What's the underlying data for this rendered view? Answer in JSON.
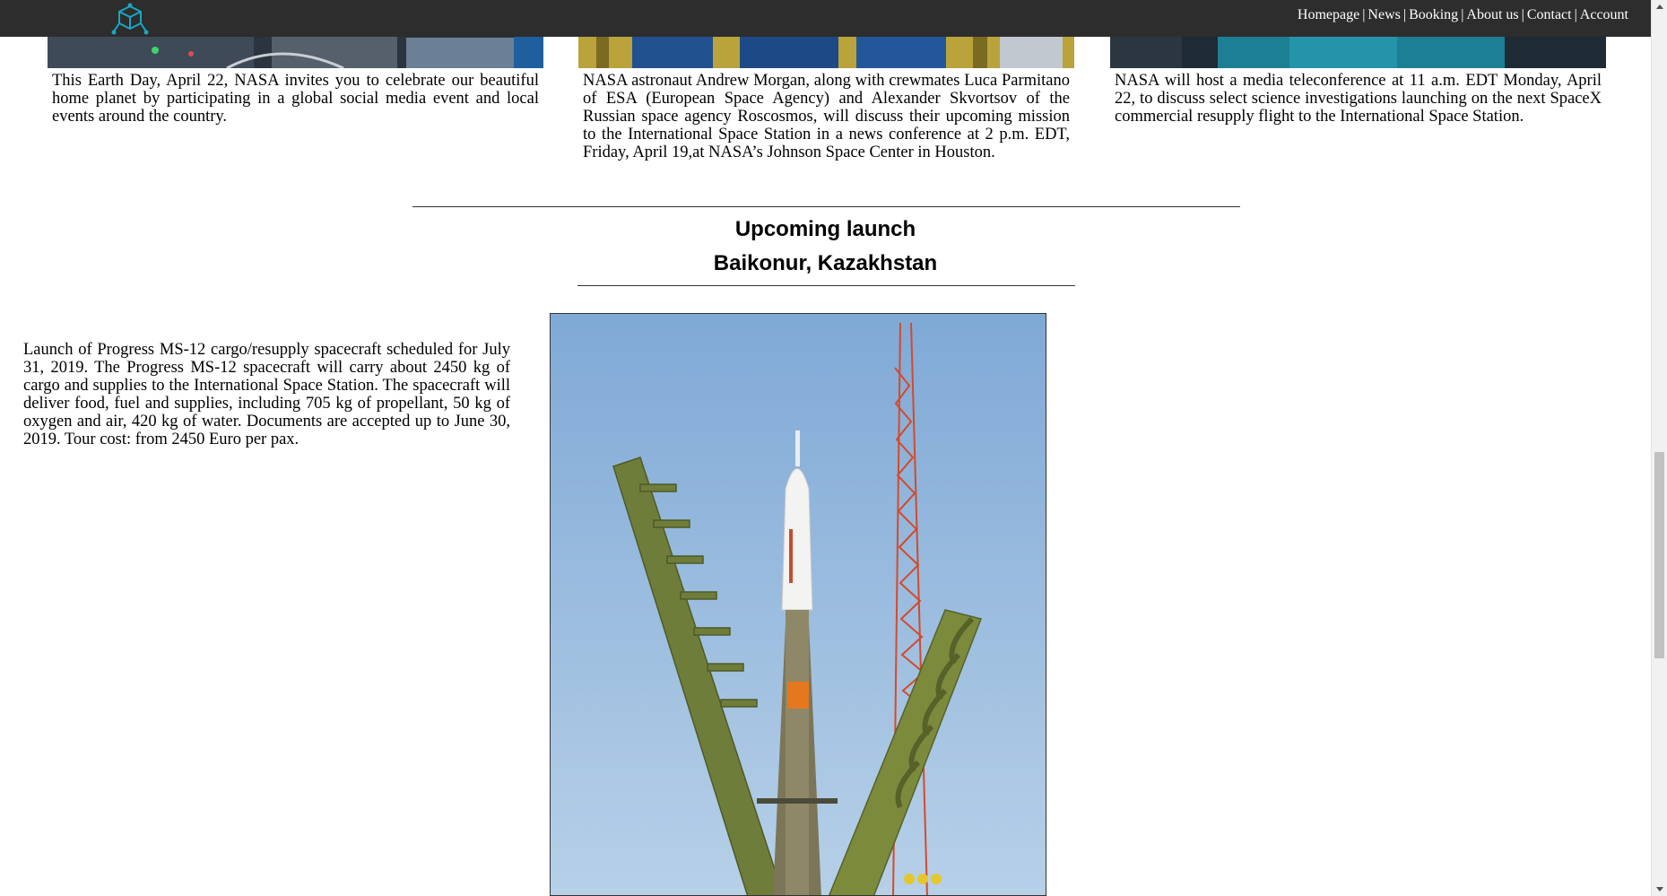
{
  "nav": {
    "items": [
      {
        "label": "Homepage"
      },
      {
        "label": "News"
      },
      {
        "label": "Booking"
      },
      {
        "label": "About us"
      },
      {
        "label": "Contact"
      },
      {
        "label": "Account"
      }
    ],
    "separator": "|"
  },
  "news": [
    {
      "text": "This Earth Day, April 22, NASA invites you to celebrate our beautiful home planet by participating in a global social media event and local events around the country."
    },
    {
      "text": "NASA astronaut Andrew Morgan, along with crewmates Luca Parmitano of ESA (European Space Agency) and Alexander Skvortsov of the Russian space agency Roscosmos, will discuss their upcoming mission to the International Space Station in a news conference at 2 p.m. EDT, Friday, April 19,at NASA’s Johnson Space Center in Houston."
    },
    {
      "text": "NASA will host a media teleconference at 11 a.m. EDT Monday, April 22, to discuss select science investigations launching on the next SpaceX commercial resupply flight to the International Space Station."
    }
  ],
  "launch": {
    "heading": "Upcoming launch",
    "location": "Baikonur, Kazakhstan",
    "description": "Launch of Progress MS-12 cargo/resupply spacecraft scheduled for July 31, 2019. The Progress MS-12 spacecraft will carry about 2450 kg of cargo and supplies to the International Space Station. The spacecraft will deliver food, fuel and supplies, including 705 kg of propellant, 50 kg of oxygen and air, 420 kg of water. Documents are accepted up to June 30, 2019. Tour cost: from 2450 Euro per pax."
  },
  "colors": {
    "topbar": "#2d2d2d",
    "logo_accent": "#1aa6c4",
    "sky": "#8fb8de",
    "gantry": "#6f7d3a"
  },
  "icons": {
    "logo": "cube-network-icon"
  }
}
